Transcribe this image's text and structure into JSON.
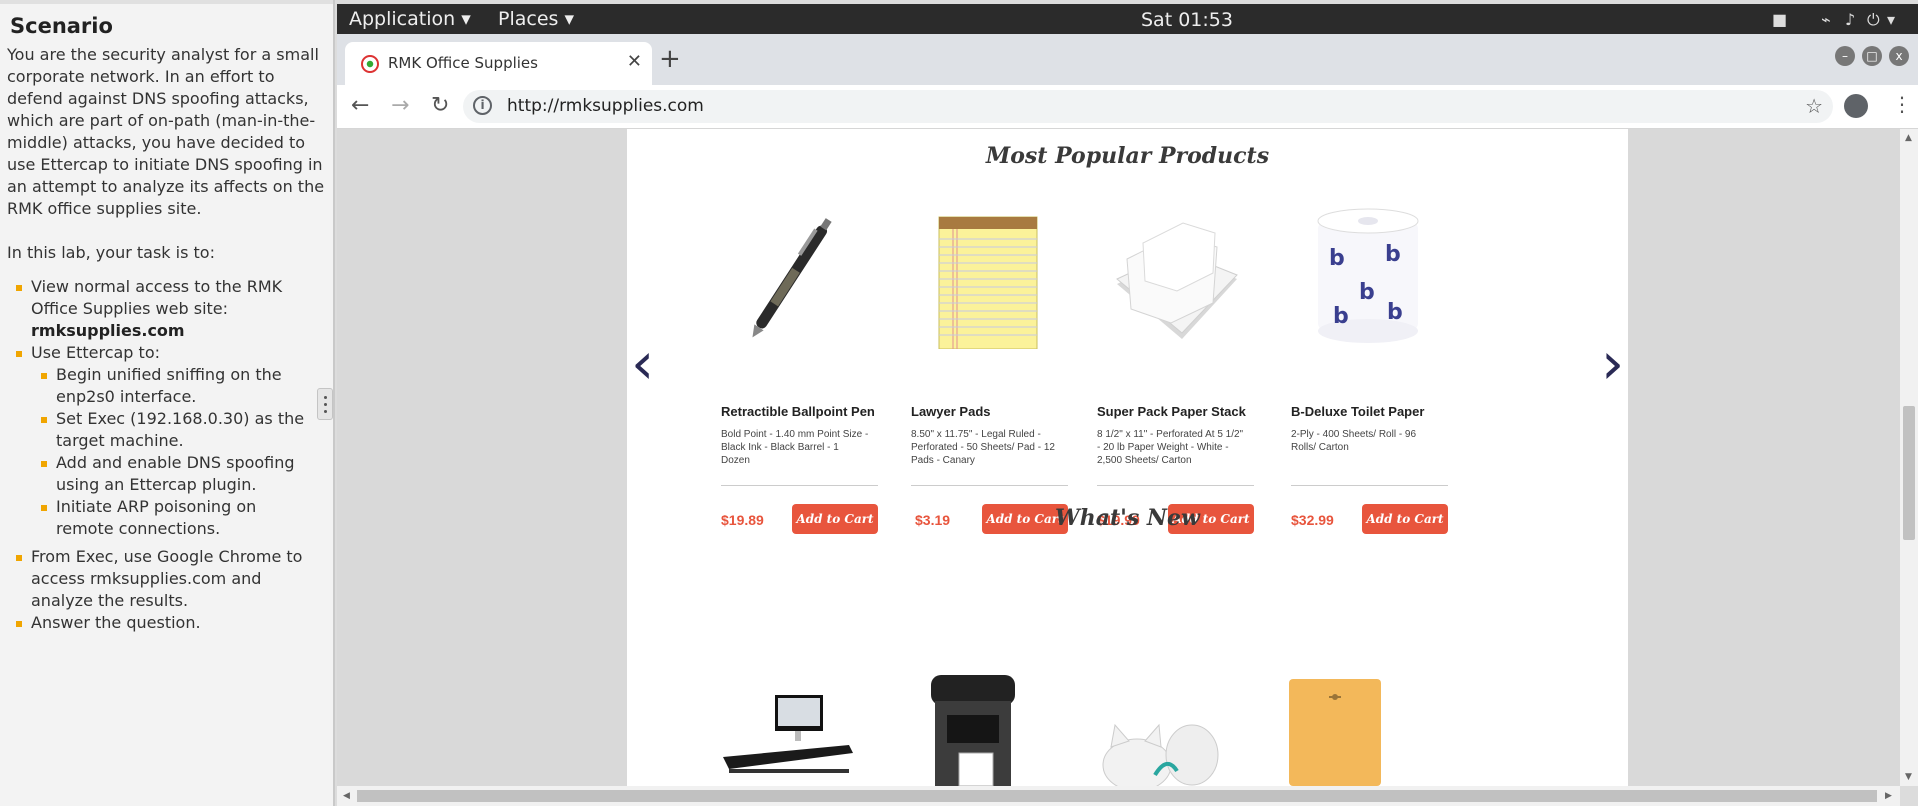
{
  "scenario": {
    "heading": "Scenario",
    "intro": "You are the security analyst for a small corporate network. In an effort to defend against DNS spoofing attacks, which are part of on-path (man-in-the-middle) attacks, you have decided to use Ettercap to initiate DNS spoofing in an attempt to analyze its affects on the RMK office supplies site.",
    "task_intro": "In this lab, your task is to:",
    "tasks": {
      "t1_text": "View normal access to the RMK Office Supplies web site: ",
      "t1_bold": "rmksupplies.com",
      "t2": "Use Ettercap to:",
      "sub1": "Begin unified sniffing on the enp2s0 interface.",
      "sub2": "Set Exec (192.168.0.30) as the target machine.",
      "sub3": "Add and enable DNS spoofing using an Ettercap plugin.",
      "sub4": "Initiate ARP poisoning on remote connections.",
      "t3": "From Exec, use Google Chrome to access rmksupplies.com and analyze the results.",
      "t4": "Answer the question."
    }
  },
  "topbar": {
    "application_menu": "Application ▾",
    "places_menu": "Places ▾",
    "clock": "Sat 01:53"
  },
  "browser": {
    "tab_title": "RMK Office Supplies",
    "tab_close": "✕",
    "new_tab": "+",
    "url": "http://rmksupplies.com",
    "info_icon": "i",
    "win_min": "–",
    "win_max": "□",
    "win_close": "x"
  },
  "page": {
    "popular_title": "Most Popular Products",
    "whats_new_title": "What's New",
    "prev_arrow": "‹",
    "next_arrow": "›",
    "products": [
      {
        "name": "Retractible Ballpoint Pen",
        "desc": "Bold Point - 1.40 mm Point Size - Black Ink - Black Barrel - 1 Dozen",
        "price": "$19.89",
        "cart": "Add to Cart"
      },
      {
        "name": "Lawyer Pads",
        "desc": "8.50\" x 11.75\" - Legal Ruled - Perforated - 50 Sheets/ Pad - 12 Pads - Canary",
        "price": "$3.19",
        "cart": "Add to Cart"
      },
      {
        "name": "Super Pack Paper Stack",
        "desc": "8 1/2\" x 11\" - Perforated At 5 1/2\" - 20 lb Paper Weight - White - 2,500 Sheets/ Carton",
        "price": "$19.99",
        "cart": "Add to Cart"
      },
      {
        "name": "B-Deluxe Toilet Paper",
        "desc": "2-Ply - 400 Sheets/ Roll - 96 Rolls/ Carton",
        "price": "$32.99",
        "cart": "Add to Cart"
      }
    ]
  }
}
